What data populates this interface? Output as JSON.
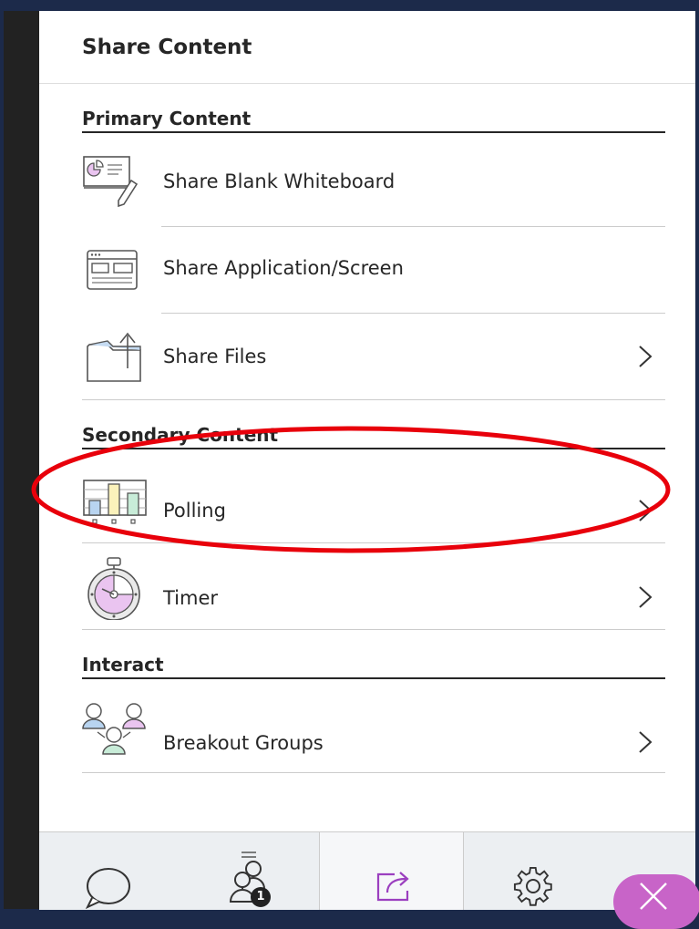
{
  "panel": {
    "title": "Share Content"
  },
  "sections": {
    "primary": "Primary Content",
    "secondary": "Secondary Content",
    "interact": "Interact"
  },
  "items": {
    "whiteboard": {
      "label": "Share Blank Whiteboard",
      "icon": "whiteboard-icon"
    },
    "application": {
      "label": "Share Application/Screen",
      "icon": "application-window-icon"
    },
    "files": {
      "label": "Share Files",
      "icon": "folder-upload-icon",
      "has_submenu": true
    },
    "polling": {
      "label": "Polling",
      "icon": "bar-chart-icon",
      "has_submenu": true,
      "highlighted": true
    },
    "timer": {
      "label": "Timer",
      "icon": "stopwatch-icon",
      "has_submenu": true
    },
    "breakout": {
      "label": "Breakout Groups",
      "icon": "breakout-groups-icon",
      "has_submenu": true
    }
  },
  "bottom_bar": {
    "tabs": [
      {
        "name": "chat",
        "icon": "chat-bubble-icon"
      },
      {
        "name": "attendees",
        "icon": "attendees-icon",
        "badge": "1"
      },
      {
        "name": "share-content",
        "icon": "share-icon",
        "active": true
      },
      {
        "name": "settings",
        "icon": "gear-icon"
      }
    ],
    "close_icon": "close-icon"
  },
  "colors": {
    "accent": "#9b3fbf",
    "close_button": "#c864c8",
    "annotation": "#e8000b",
    "chart_blue": "#b8d4f0",
    "chart_yellow": "#fbf2bb",
    "chart_green": "#c8ecd8",
    "purple_fill": "#eac4f0",
    "folder_blue": "#c5dbf2",
    "page_border": "#1c2a4a"
  }
}
